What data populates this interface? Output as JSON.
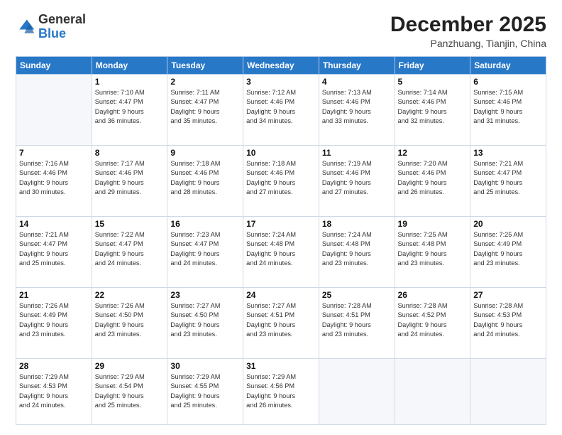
{
  "logo": {
    "general": "General",
    "blue": "Blue"
  },
  "header": {
    "month": "December 2025",
    "location": "Panzhuang, Tianjin, China"
  },
  "weekdays": [
    "Sunday",
    "Monday",
    "Tuesday",
    "Wednesday",
    "Thursday",
    "Friday",
    "Saturday"
  ],
  "weeks": [
    [
      {
        "day": "",
        "text": ""
      },
      {
        "day": "1",
        "text": "Sunrise: 7:10 AM\nSunset: 4:47 PM\nDaylight: 9 hours\nand 36 minutes."
      },
      {
        "day": "2",
        "text": "Sunrise: 7:11 AM\nSunset: 4:47 PM\nDaylight: 9 hours\nand 35 minutes."
      },
      {
        "day": "3",
        "text": "Sunrise: 7:12 AM\nSunset: 4:46 PM\nDaylight: 9 hours\nand 34 minutes."
      },
      {
        "day": "4",
        "text": "Sunrise: 7:13 AM\nSunset: 4:46 PM\nDaylight: 9 hours\nand 33 minutes."
      },
      {
        "day": "5",
        "text": "Sunrise: 7:14 AM\nSunset: 4:46 PM\nDaylight: 9 hours\nand 32 minutes."
      },
      {
        "day": "6",
        "text": "Sunrise: 7:15 AM\nSunset: 4:46 PM\nDaylight: 9 hours\nand 31 minutes."
      }
    ],
    [
      {
        "day": "7",
        "text": "Sunrise: 7:16 AM\nSunset: 4:46 PM\nDaylight: 9 hours\nand 30 minutes."
      },
      {
        "day": "8",
        "text": "Sunrise: 7:17 AM\nSunset: 4:46 PM\nDaylight: 9 hours\nand 29 minutes."
      },
      {
        "day": "9",
        "text": "Sunrise: 7:18 AM\nSunset: 4:46 PM\nDaylight: 9 hours\nand 28 minutes."
      },
      {
        "day": "10",
        "text": "Sunrise: 7:18 AM\nSunset: 4:46 PM\nDaylight: 9 hours\nand 27 minutes."
      },
      {
        "day": "11",
        "text": "Sunrise: 7:19 AM\nSunset: 4:46 PM\nDaylight: 9 hours\nand 27 minutes."
      },
      {
        "day": "12",
        "text": "Sunrise: 7:20 AM\nSunset: 4:46 PM\nDaylight: 9 hours\nand 26 minutes."
      },
      {
        "day": "13",
        "text": "Sunrise: 7:21 AM\nSunset: 4:47 PM\nDaylight: 9 hours\nand 25 minutes."
      }
    ],
    [
      {
        "day": "14",
        "text": "Sunrise: 7:21 AM\nSunset: 4:47 PM\nDaylight: 9 hours\nand 25 minutes."
      },
      {
        "day": "15",
        "text": "Sunrise: 7:22 AM\nSunset: 4:47 PM\nDaylight: 9 hours\nand 24 minutes."
      },
      {
        "day": "16",
        "text": "Sunrise: 7:23 AM\nSunset: 4:47 PM\nDaylight: 9 hours\nand 24 minutes."
      },
      {
        "day": "17",
        "text": "Sunrise: 7:24 AM\nSunset: 4:48 PM\nDaylight: 9 hours\nand 24 minutes."
      },
      {
        "day": "18",
        "text": "Sunrise: 7:24 AM\nSunset: 4:48 PM\nDaylight: 9 hours\nand 23 minutes."
      },
      {
        "day": "19",
        "text": "Sunrise: 7:25 AM\nSunset: 4:48 PM\nDaylight: 9 hours\nand 23 minutes."
      },
      {
        "day": "20",
        "text": "Sunrise: 7:25 AM\nSunset: 4:49 PM\nDaylight: 9 hours\nand 23 minutes."
      }
    ],
    [
      {
        "day": "21",
        "text": "Sunrise: 7:26 AM\nSunset: 4:49 PM\nDaylight: 9 hours\nand 23 minutes."
      },
      {
        "day": "22",
        "text": "Sunrise: 7:26 AM\nSunset: 4:50 PM\nDaylight: 9 hours\nand 23 minutes."
      },
      {
        "day": "23",
        "text": "Sunrise: 7:27 AM\nSunset: 4:50 PM\nDaylight: 9 hours\nand 23 minutes."
      },
      {
        "day": "24",
        "text": "Sunrise: 7:27 AM\nSunset: 4:51 PM\nDaylight: 9 hours\nand 23 minutes."
      },
      {
        "day": "25",
        "text": "Sunrise: 7:28 AM\nSunset: 4:51 PM\nDaylight: 9 hours\nand 23 minutes."
      },
      {
        "day": "26",
        "text": "Sunrise: 7:28 AM\nSunset: 4:52 PM\nDaylight: 9 hours\nand 24 minutes."
      },
      {
        "day": "27",
        "text": "Sunrise: 7:28 AM\nSunset: 4:53 PM\nDaylight: 9 hours\nand 24 minutes."
      }
    ],
    [
      {
        "day": "28",
        "text": "Sunrise: 7:29 AM\nSunset: 4:53 PM\nDaylight: 9 hours\nand 24 minutes."
      },
      {
        "day": "29",
        "text": "Sunrise: 7:29 AM\nSunset: 4:54 PM\nDaylight: 9 hours\nand 25 minutes."
      },
      {
        "day": "30",
        "text": "Sunrise: 7:29 AM\nSunset: 4:55 PM\nDaylight: 9 hours\nand 25 minutes."
      },
      {
        "day": "31",
        "text": "Sunrise: 7:29 AM\nSunset: 4:56 PM\nDaylight: 9 hours\nand 26 minutes."
      },
      {
        "day": "",
        "text": ""
      },
      {
        "day": "",
        "text": ""
      },
      {
        "day": "",
        "text": ""
      }
    ]
  ]
}
